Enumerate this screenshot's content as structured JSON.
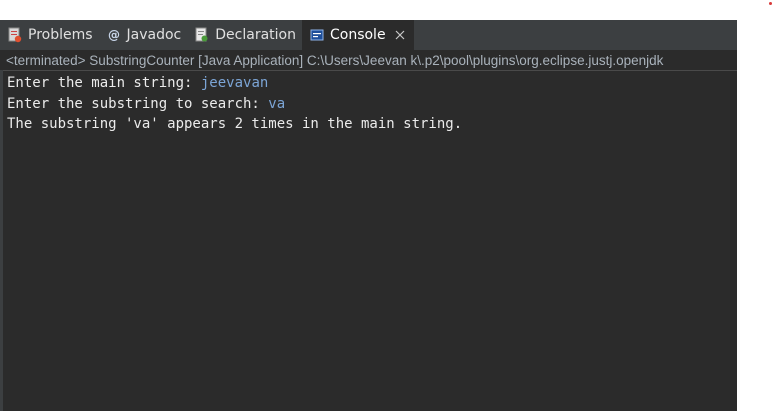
{
  "tabs": [
    {
      "label": "Problems",
      "icon": "problems-icon"
    },
    {
      "label": "Javadoc",
      "icon": "javadoc-icon"
    },
    {
      "label": "Declaration",
      "icon": "declaration-icon"
    },
    {
      "label": "Console",
      "icon": "console-icon",
      "active": true
    }
  ],
  "status": {
    "text": "<terminated> SubstringCounter [Java Application] C:\\Users\\Jeevan k\\.p2\\pool\\plugins\\org.eclipse.justj.openjdk"
  },
  "console": {
    "lines": [
      {
        "prompt": "Enter the main string: ",
        "input": "jeevavan"
      },
      {
        "prompt": "Enter the substring to search: ",
        "input": "va"
      },
      {
        "prompt": "The substring 'va' appears 2 times in the main string.",
        "input": ""
      }
    ]
  },
  "colors": {
    "background": "#2b2b2b",
    "tabbar": "#3c3f41",
    "output_text": "#ebebeb",
    "input_text": "#7ca5d6"
  }
}
